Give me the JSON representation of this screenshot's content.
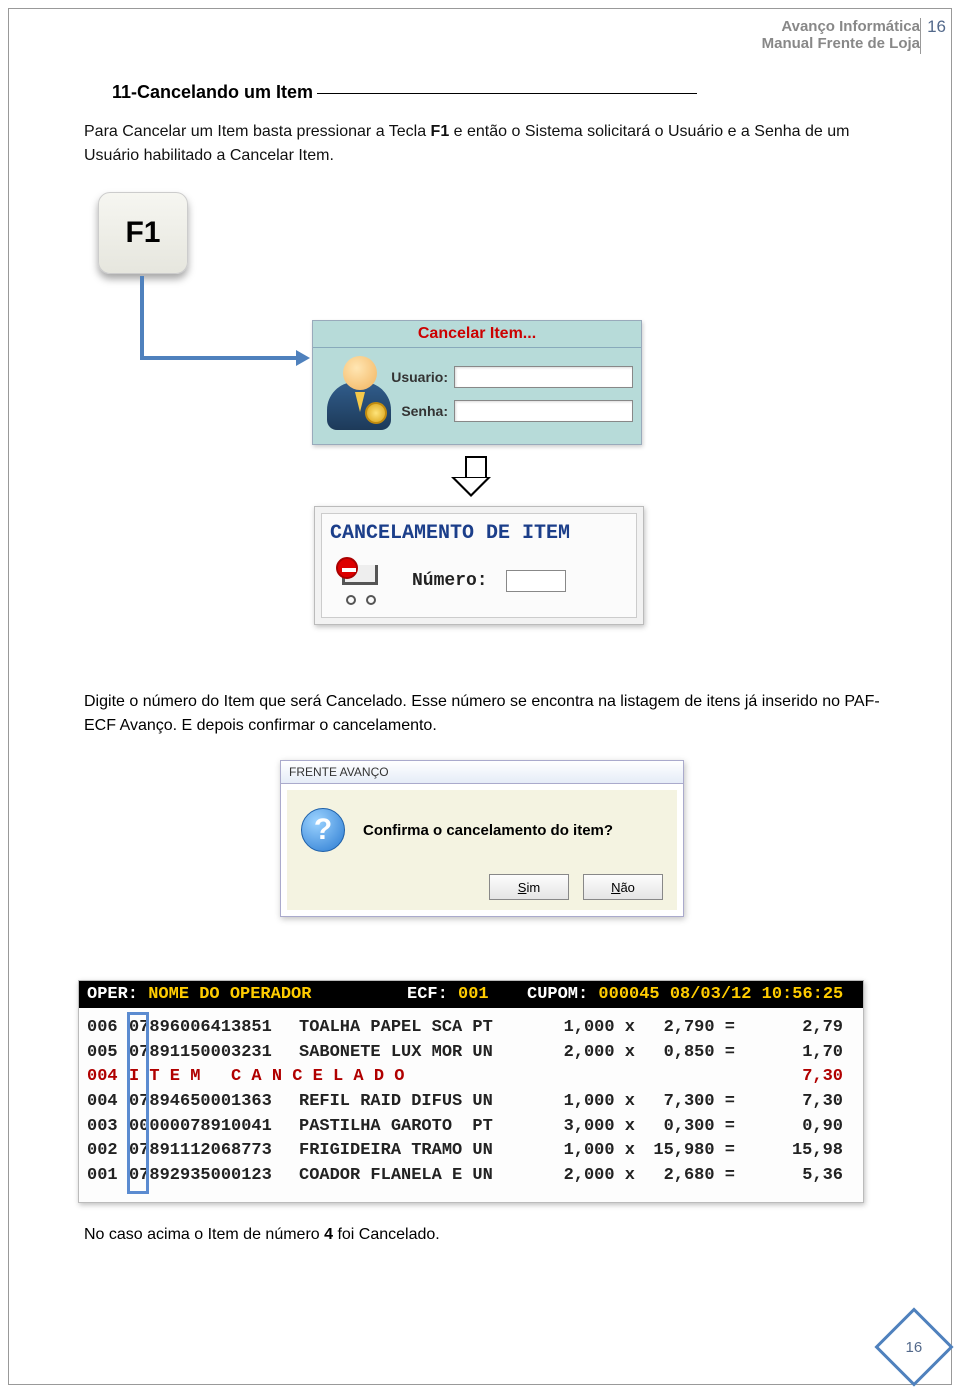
{
  "header": {
    "line1": "Avanço Informática",
    "line2": "Manual Frente de Loja",
    "page_number_top": "16"
  },
  "section": {
    "title": "11-Cancelando um Item"
  },
  "intro": {
    "p1a": "Para Cancelar um Item basta pressionar a Tecla ",
    "bold": "F1",
    "p1b": " e então o Sistema solicitará o Usuário e a Senha de um Usuário habilitado a Cancelar Item."
  },
  "f1_key": {
    "label": "F1"
  },
  "login_dialog": {
    "title": "Cancelar Item...",
    "usuario_label": "Usuario:",
    "senha_label": "Senha:",
    "usuario_value": "",
    "senha_value": ""
  },
  "cancel_dialog": {
    "title": "CANCELAMENTO DE ITEM",
    "numero_label": "Número:",
    "numero_value": ""
  },
  "mid": {
    "text": "Digite o número do Item que será Cancelado. Esse número se encontra na listagem de itens já inserido no PAF-ECF Avanço. E depois confirmar o cancelamento."
  },
  "confirm_dialog": {
    "titlebar": "FRENTE AVANÇO",
    "message": "Confirma o cancelamento do item?",
    "yes_u": "S",
    "yes_rest": "im",
    "no_u": "N",
    "no_rest": "ão"
  },
  "receipt": {
    "header": {
      "oper_label": "OPER:",
      "oper_value": " NOME DO OPERADOR",
      "ecf_label": "ECF:",
      "ecf_value": " 001",
      "cupom_label": "CUPOM:",
      "cupom_value": " 000045 08/03/12 10:56:25"
    },
    "rows": [
      {
        "seq": "006",
        "code": "07896006413851",
        "desc": "TOALHA PAPEL SCA PT",
        "qty": "1,000 x",
        "price": "2,790 =",
        "total": "2,79",
        "cancel": false
      },
      {
        "seq": "005",
        "code": "07891150003231",
        "desc": "SABONETE LUX MOR UN",
        "qty": "2,000 x",
        "price": "0,850 =",
        "total": "1,70",
        "cancel": false
      },
      {
        "seq": "004",
        "code": "",
        "desc": "I T E M   C A N C E L A D O",
        "qty": "",
        "price": "",
        "total": "7,30",
        "cancel": true
      },
      {
        "seq": "004",
        "code": "07894650001363",
        "desc": "REFIL RAID DIFUS UN",
        "qty": "1,000 x",
        "price": "7,300 =",
        "total": "7,30",
        "cancel": false
      },
      {
        "seq": "003",
        "code": "00000078910041",
        "desc": "PASTILHA GAROTO  PT",
        "qty": "3,000 x",
        "price": "0,300 =",
        "total": "0,90",
        "cancel": false
      },
      {
        "seq": "002",
        "code": "07891112068773",
        "desc": "FRIGIDEIRA TRAMO UN",
        "qty": "1,000 x",
        "price": "15,980 =",
        "total": "15,98",
        "cancel": false
      },
      {
        "seq": "001",
        "code": "07892935000123",
        "desc": "COADOR FLANELA E UN",
        "qty": "2,000 x",
        "price": "2,680 =",
        "total": "5,36",
        "cancel": false
      }
    ]
  },
  "final": {
    "a": "No caso acima o Item de número ",
    "bold": "4",
    "b": " foi Cancelado."
  },
  "footer": {
    "page": "16"
  }
}
